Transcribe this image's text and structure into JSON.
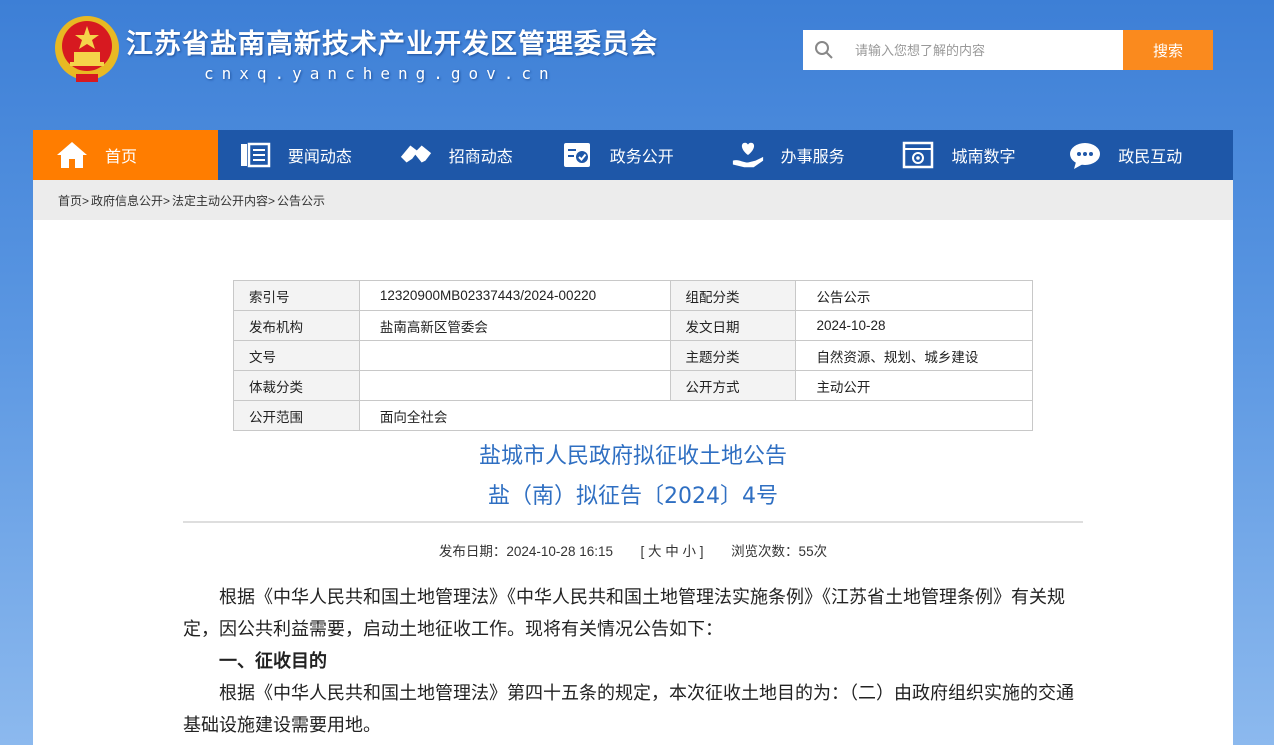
{
  "header": {
    "title": "江苏省盐南高新技术产业开发区管理委员会",
    "domain": "cnxq.yancheng.gov.cn",
    "search_placeholder": "请输入您想了解的内容",
    "search_button": "搜索"
  },
  "nav": {
    "items": [
      {
        "label": "首页",
        "icon": "home-icon"
      },
      {
        "label": "要闻动态",
        "icon": "news-icon"
      },
      {
        "label": "招商动态",
        "icon": "handshake-icon"
      },
      {
        "label": "政务公开",
        "icon": "document-check-icon"
      },
      {
        "label": "办事服务",
        "icon": "heart-hand-icon"
      },
      {
        "label": "城南数字",
        "icon": "data-screen-icon"
      },
      {
        "label": "政民互动",
        "icon": "chat-icon"
      }
    ]
  },
  "breadcrumb": [
    "首页>",
    "政府信息公开>",
    "法定主动公开内容>",
    "公告公示"
  ],
  "meta": {
    "index_label": "索引号",
    "index_value": "12320900MB02337443/2024-00220",
    "category_label": "组配分类",
    "category_value": "公告公示",
    "publisher_label": "发布机构",
    "publisher_value": "盐南高新区管委会",
    "date_label": "发文日期",
    "date_value": "2024-10-28",
    "docno_label": "文号",
    "docno_value": "",
    "topic_label": "主题分类",
    "topic_value": "自然资源、规划、城乡建设",
    "genre_label": "体裁分类",
    "genre_value": "",
    "mode_label": "公开方式",
    "mode_value": "主动公开",
    "scope_label": "公开范围",
    "scope_value": "面向全社会"
  },
  "article": {
    "title": "盐城市人民政府拟征收土地公告",
    "subtitle": "盐（南）拟征告〔2024〕4号",
    "publish_info": "发布日期：2024-10-28 16:15",
    "font_size_label": "[ 大 中 小 ]",
    "views": "浏览次数：55次",
    "p1": "根据《中华人民共和国土地管理法》《中华人民共和国土地管理法实施条例》《江苏省土地管理条例》有关规定，因公共利益需要，启动土地征收工作。现将有关情况公告如下：",
    "h1": "一、征收目的",
    "p2": "根据《中华人民共和国土地管理法》第四十五条的规定，本次征收土地目的为：（二）由政府组织实施的交通基础设施建设需要用地。"
  }
}
